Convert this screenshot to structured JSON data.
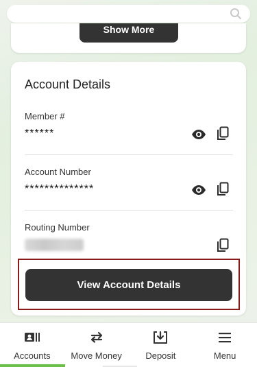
{
  "search": {
    "placeholder": "",
    "value": ""
  },
  "top_card": {
    "show_more_label": "Show More"
  },
  "account_details": {
    "title": "Account Details",
    "fields": [
      {
        "label": "Member #",
        "value": "******"
      },
      {
        "label": "Account Number",
        "value": "**************"
      },
      {
        "label": "Routing Number",
        "value": ""
      }
    ],
    "view_button_label": "View Account Details"
  },
  "bottom_nav": {
    "items": [
      {
        "label": "Accounts",
        "icon": "accounts-icon",
        "active": true
      },
      {
        "label": "Move Money",
        "icon": "transfer-arrows-icon",
        "active": false
      },
      {
        "label": "Deposit",
        "icon": "deposit-icon",
        "active": false
      },
      {
        "label": "Menu",
        "icon": "hamburger-menu-icon",
        "active": false
      }
    ],
    "active_color": "#6cc04a"
  },
  "colors": {
    "button_dark": "#333333",
    "highlight_border": "#8b1a1a",
    "background_tint": "#e3efdf"
  }
}
